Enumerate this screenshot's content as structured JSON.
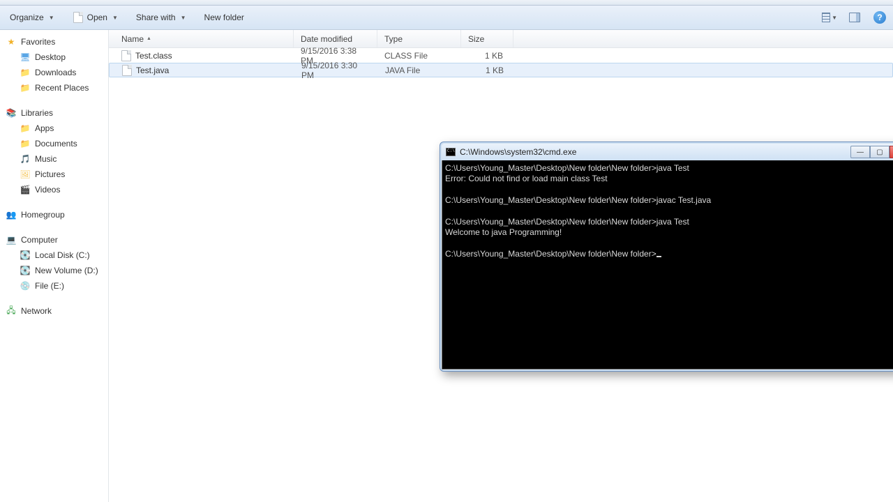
{
  "toolbar": {
    "organize": "Organize",
    "open": "Open",
    "share": "Share with",
    "newfolder": "New folder"
  },
  "sidebar": {
    "favorites": {
      "label": "Favorites",
      "items": [
        "Desktop",
        "Downloads",
        "Recent Places"
      ]
    },
    "libraries": {
      "label": "Libraries",
      "items": [
        "Apps",
        "Documents",
        "Music",
        "Pictures",
        "Videos"
      ]
    },
    "homegroup": {
      "label": "Homegroup"
    },
    "computer": {
      "label": "Computer",
      "items": [
        "Local Disk (C:)",
        "New Volume (D:)",
        "File (E:)"
      ]
    },
    "network": {
      "label": "Network"
    }
  },
  "columns": {
    "name": "Name",
    "modified": "Date modified",
    "type": "Type",
    "size": "Size"
  },
  "files": [
    {
      "name": "Test.class",
      "modified": "9/15/2016 3:38 PM",
      "type": "CLASS File",
      "size": "1 KB"
    },
    {
      "name": "Test.java",
      "modified": "9/15/2016 3:30 PM",
      "type": "JAVA File",
      "size": "1 KB"
    }
  ],
  "cmd": {
    "title": "C:\\Windows\\system32\\cmd.exe",
    "lines": [
      "C:\\Users\\Young_Master\\Desktop\\New folder\\New folder>java Test",
      "Error: Could not find or load main class Test",
      "",
      "C:\\Users\\Young_Master\\Desktop\\New folder\\New folder>javac Test.java",
      "",
      "C:\\Users\\Young_Master\\Desktop\\New folder\\New folder>java Test",
      "Welcome to java Programming!",
      "",
      "C:\\Users\\Young_Master\\Desktop\\New folder\\New folder>"
    ]
  }
}
